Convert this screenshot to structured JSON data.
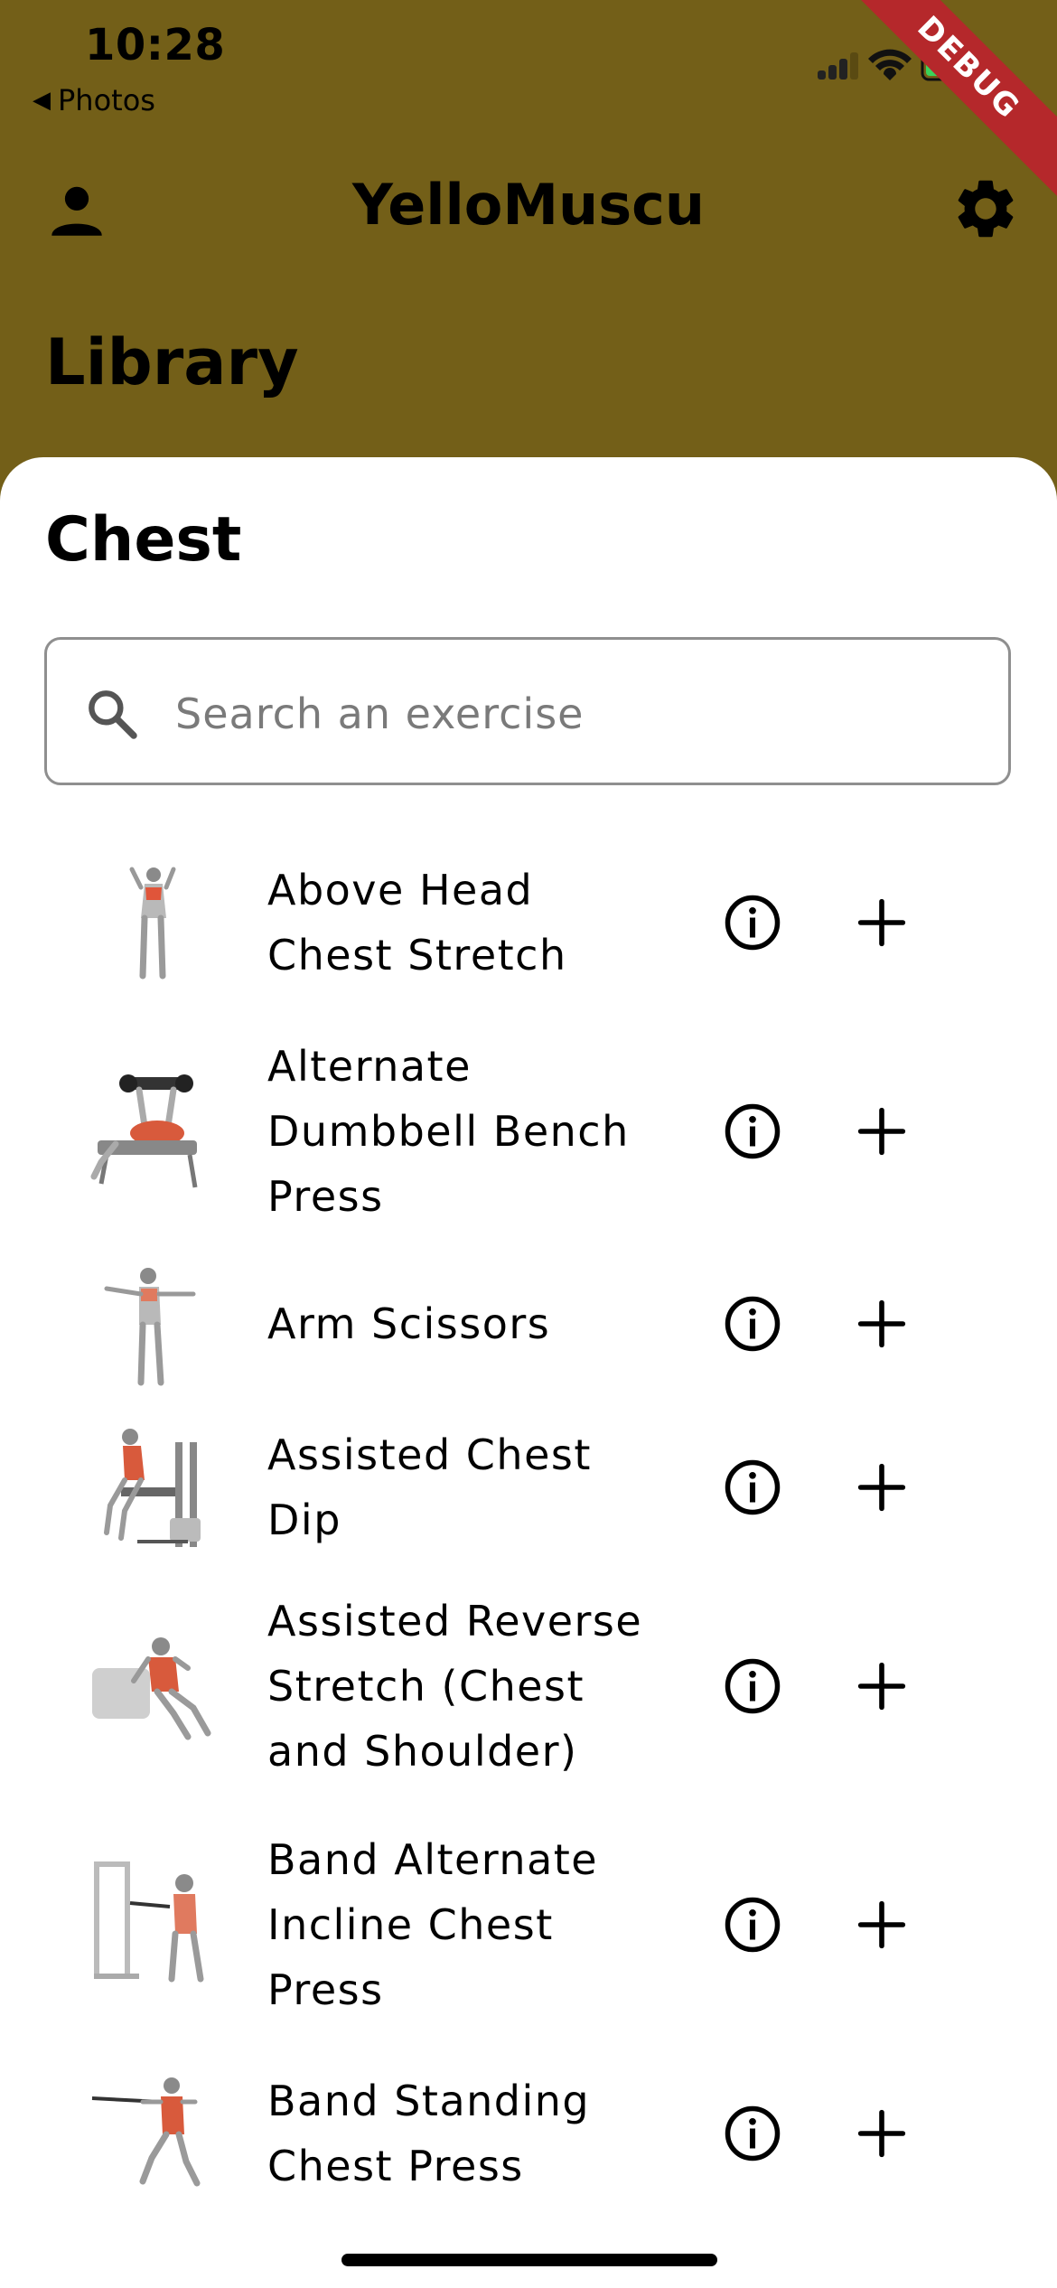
{
  "status_bar": {
    "time": "10:28",
    "back_app": "Photos",
    "debug_label": "DEBUG"
  },
  "app_bar": {
    "title": "YelloMuscu"
  },
  "page_heading": "Library",
  "section_title": "Chest",
  "search": {
    "placeholder": "Search an exercise",
    "value": ""
  },
  "colors": {
    "header_bg": "#735f18",
    "sheet_bg": "#ffffff",
    "debug_banner": "#b5282b"
  },
  "exercises": [
    {
      "name": "Above Head Chest Stretch",
      "image": "standing-stretch-figure"
    },
    {
      "name": "Alternate Dumbbell Bench Press",
      "image": "bench-press-figure"
    },
    {
      "name": "Arm Scissors",
      "image": "standing-arms-figure"
    },
    {
      "name": "Assisted Chest Dip",
      "image": "dip-machine-figure"
    },
    {
      "name": "Assisted Reverse Stretch (Chest and Shoulder)",
      "image": "seated-stretch-figure"
    },
    {
      "name": "Band Alternate Incline Chest Press",
      "image": "band-rack-figure"
    },
    {
      "name": "Band Standing Chest Press",
      "image": "band-press-figure"
    }
  ]
}
